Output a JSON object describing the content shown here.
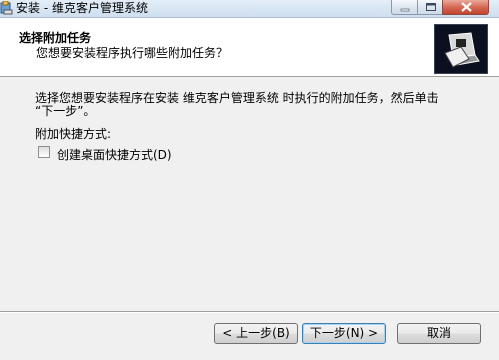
{
  "window": {
    "title": "安装 - 维克客户管理系统"
  },
  "header": {
    "title": "选择附加任务",
    "subtitle": "您想要安装程序执行哪些附加任务？"
  },
  "body": {
    "description_line1": "选择您想要安装程序在安装 维克客户管理系统 时执行的附加任务，然后单击",
    "description_line2": "“下一步”。",
    "shortcuts_label": "附加快捷方式:",
    "desktop_shortcut": {
      "label": "创建桌面快捷方式(D)",
      "checked": false
    }
  },
  "footer": {
    "back_label": "< 上一步(B)",
    "next_label": "下一步(N) >",
    "cancel_label": "取消"
  }
}
